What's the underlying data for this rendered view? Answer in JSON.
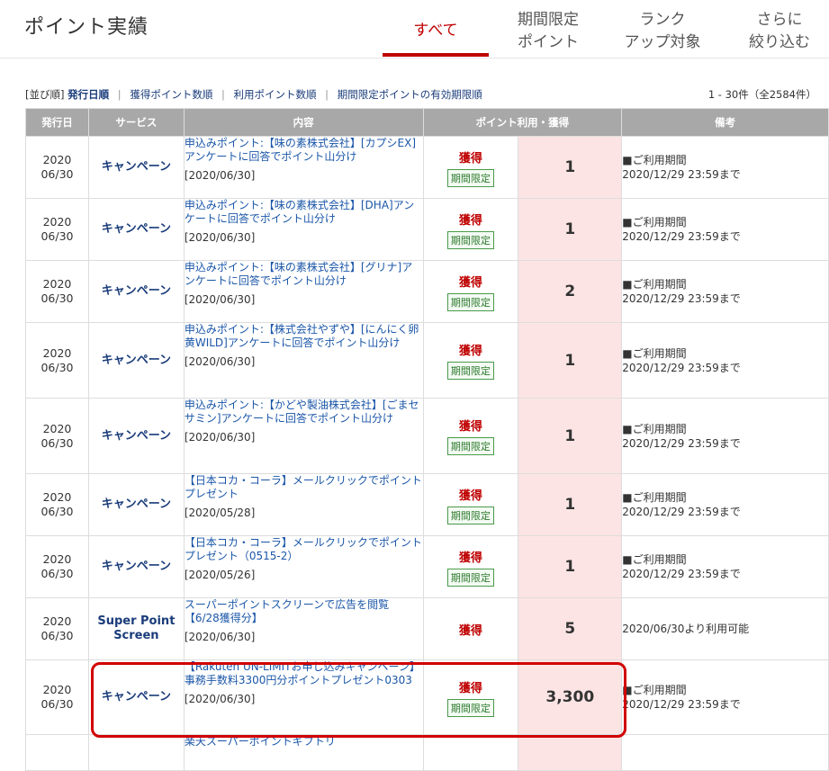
{
  "page_title": "ポイント実績",
  "tabs": [
    {
      "line1": "すべて",
      "line2": ""
    },
    {
      "line1": "期間限定",
      "line2": "ポイント"
    },
    {
      "line1": "ランク",
      "line2": "アップ対象"
    },
    {
      "line1": "さらに",
      "line2": "絞り込む"
    }
  ],
  "sort": {
    "prefix": "[並び順]",
    "selected": "発行日順",
    "options": [
      "獲得ポイント数順",
      "利用ポイント数順",
      "期間限定ポイントの有効期限順"
    ]
  },
  "count_text": "1 - 30件（全2584件）",
  "columns": [
    "発行日",
    "サービス",
    "内容",
    "ポイント利用・獲得",
    "備考"
  ],
  "rows": [
    {
      "date1": "2020",
      "date2": "06/30",
      "service": "キャンペーン",
      "content": "申込みポイント:【味の素株式会社】[カプシEX]アンケートに回答でポイント山分け",
      "content_date": "[2020/06/30]",
      "type": "獲得",
      "badge": "期間限定",
      "points": "1",
      "note1": "■ご利用期間",
      "note2": "2020/12/29 23:59まで"
    },
    {
      "date1": "2020",
      "date2": "06/30",
      "service": "キャンペーン",
      "content": "申込みポイント:【味の素株式会社】[DHA]アンケートに回答でポイント山分け",
      "content_date": "[2020/06/30]",
      "type": "獲得",
      "badge": "期間限定",
      "points": "1",
      "note1": "■ご利用期間",
      "note2": "2020/12/29 23:59まで"
    },
    {
      "date1": "2020",
      "date2": "06/30",
      "service": "キャンペーン",
      "content": "申込みポイント:【味の素株式会社】[グリナ]アンケートに回答でポイント山分け",
      "content_date": "[2020/06/30]",
      "type": "獲得",
      "badge": "期間限定",
      "points": "2",
      "note1": "■ご利用期間",
      "note2": "2020/12/29 23:59まで"
    },
    {
      "date1": "2020",
      "date2": "06/30",
      "service": "キャンペーン",
      "content": "申込みポイント:【株式会社やずや】[にんにく卵黄WILD]アンケートに回答でポイント山分け",
      "content_date": "[2020/06/30]",
      "type": "獲得",
      "badge": "期間限定",
      "points": "1",
      "note1": "■ご利用期間",
      "note2": "2020/12/29 23:59まで"
    },
    {
      "date1": "2020",
      "date2": "06/30",
      "service": "キャンペーン",
      "content": "申込みポイント:【かどや製油株式会社】[ごまセサミン]アンケートに回答でポイント山分け",
      "content_date": "[2020/06/30]",
      "type": "獲得",
      "badge": "期間限定",
      "points": "1",
      "note1": "■ご利用期間",
      "note2": "2020/12/29 23:59まで"
    },
    {
      "date1": "2020",
      "date2": "06/30",
      "service": "キャンペーン",
      "content": "【日本コカ・コーラ】メールクリックでポイントプレゼント",
      "content_date": "[2020/05/28]",
      "type": "獲得",
      "badge": "期間限定",
      "points": "1",
      "note1": "■ご利用期間",
      "note2": "2020/12/29 23:59まで"
    },
    {
      "date1": "2020",
      "date2": "06/30",
      "service": "キャンペーン",
      "content": "【日本コカ・コーラ】メールクリックでポイントプレゼント（0515-2）",
      "content_date": "[2020/05/26]",
      "type": "獲得",
      "badge": "期間限定",
      "points": "1",
      "note1": "■ご利用期間",
      "note2": "2020/12/29 23:59まで"
    },
    {
      "date1": "2020",
      "date2": "06/30",
      "service": "Super Point Screen",
      "content": "スーパーポイントスクリーンで広告を閲覧【6/28獲得分】",
      "content_date": "[2020/06/30]",
      "type": "獲得",
      "badge": "",
      "points": "5",
      "note1": "2020/06/30より利用可能",
      "note2": ""
    },
    {
      "date1": "2020",
      "date2": "06/30",
      "service": "キャンペーン",
      "content": "【Rakuten UN-LIMITお申し込みキャンペーン】事務手数料3300円分ポイントプレゼント0303",
      "content_date": "[2020/06/30]",
      "type": "獲得",
      "badge": "期間限定",
      "points": "3,300",
      "note1": "■ご利用期間",
      "note2": "2020/12/29 23:59まで"
    },
    {
      "date1": "",
      "date2": "",
      "service": "",
      "content": "楽天スーパーポイントギフトリ",
      "content_date": "",
      "type": "",
      "badge": "",
      "points": "",
      "note1": "",
      "note2": ""
    }
  ]
}
